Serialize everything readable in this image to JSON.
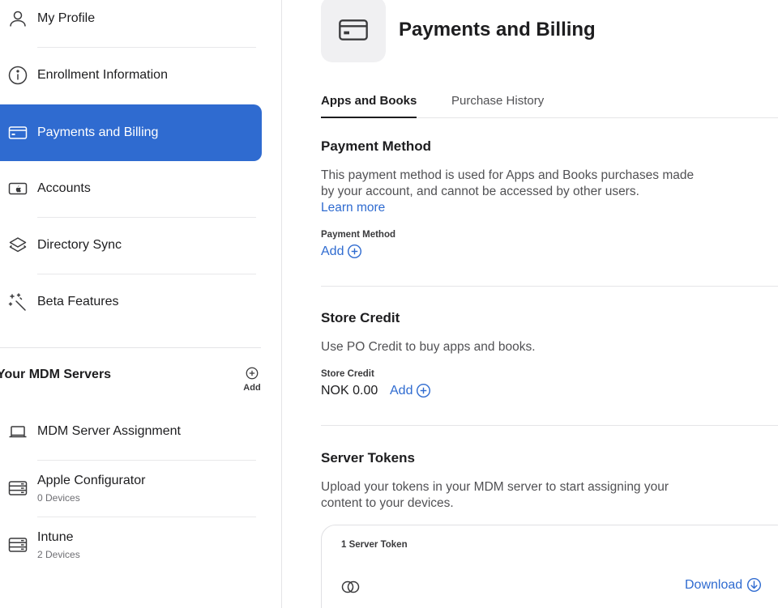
{
  "sidebar": {
    "items": [
      {
        "label": "My Profile",
        "icon": "person-icon"
      },
      {
        "label": "Enrollment Information",
        "icon": "info-icon"
      },
      {
        "label": "Payments and Billing",
        "icon": "credit-card-icon",
        "active": true
      },
      {
        "label": "Accounts",
        "icon": "apple-card-icon"
      },
      {
        "label": "Directory Sync",
        "icon": "layers-icon"
      },
      {
        "label": "Beta Features",
        "icon": "magic-wand-icon"
      }
    ],
    "servers_title": "Your MDM Servers",
    "add_label": "Add",
    "servers": [
      {
        "label": "MDM Server Assignment",
        "icon": "laptop-icon"
      },
      {
        "label": "Apple Configurator",
        "sub": "0 Devices",
        "icon": "server-icon"
      },
      {
        "label": "Intune",
        "sub": "2 Devices",
        "icon": "server-icon"
      }
    ]
  },
  "main": {
    "title": "Payments and Billing",
    "tabs": [
      {
        "label": "Apps and Books",
        "active": true
      },
      {
        "label": "Purchase History"
      }
    ],
    "payment_method": {
      "heading": "Payment Method",
      "description": "This payment method is used for Apps and Books purchases made by your account, and cannot be accessed by other users.",
      "learn_more": "Learn more",
      "field_label": "Payment Method",
      "add_label": "Add"
    },
    "store_credit": {
      "heading": "Store Credit",
      "description": "Use PO Credit to buy apps and books.",
      "field_label": "Store Credit",
      "amount": "NOK 0.00",
      "add_label": "Add"
    },
    "server_tokens": {
      "heading": "Server Tokens",
      "description": "Upload your tokens in your MDM server to start assigning your content to your devices.",
      "count_label": "1 Server Token",
      "download_label": "Download"
    }
  },
  "colors": {
    "accent": "#2f6bd0",
    "text": "#1d1d1f",
    "secondary_text": "#515154"
  }
}
